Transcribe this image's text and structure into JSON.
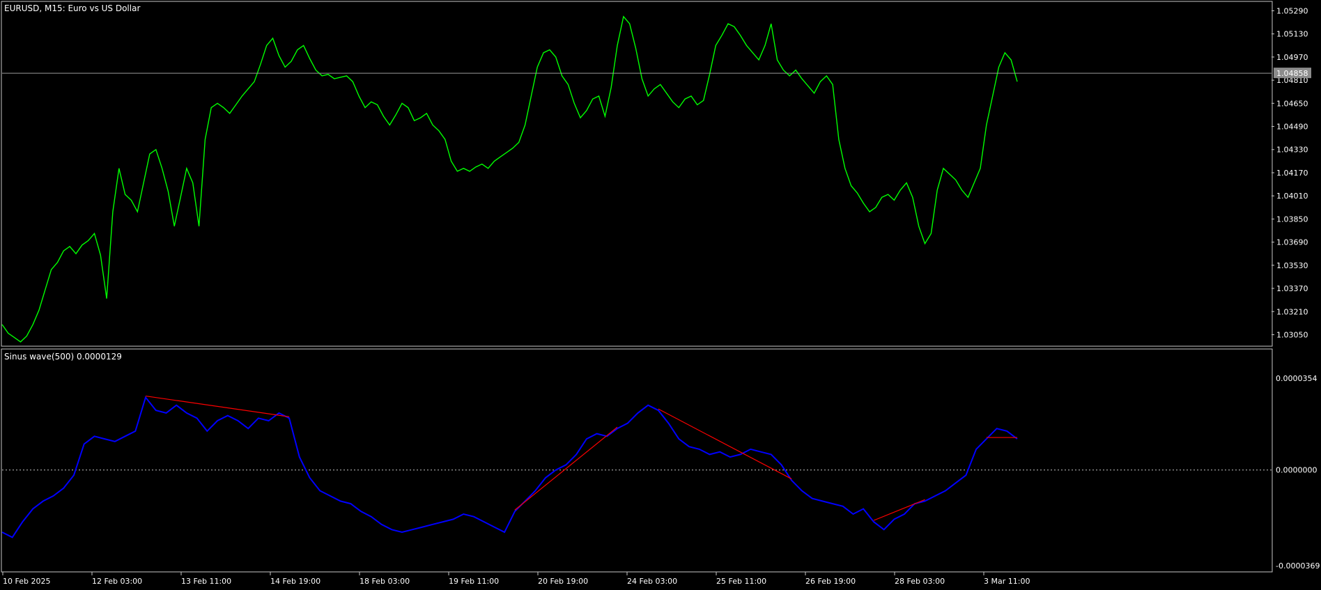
{
  "header": {
    "main_title": "EURUSD, M15:  Euro vs US Dollar",
    "indicator_title": "Sinus wave(500) 0.0000129"
  },
  "colors": {
    "background": "#000000",
    "price_line": "#00ff00",
    "indicator_line": "#0000ff",
    "divergence_line": "#ff0000",
    "frame": "#c8c8c8",
    "grid_zero": "#c8c8c8"
  },
  "price_axis": {
    "ticks": [
      "1.05290",
      "1.05130",
      "1.04970",
      "1.04810",
      "1.04650",
      "1.04490",
      "1.04330",
      "1.04170",
      "1.04010",
      "1.03850",
      "1.03690",
      "1.03530",
      "1.03370",
      "1.03210",
      "1.03050"
    ],
    "current_price": "1.04858"
  },
  "indicator_axis": {
    "ticks": [
      "0.0000354",
      "0.0000000",
      "-0.0000369"
    ]
  },
  "time_axis": {
    "labels": [
      "10 Feb 2025",
      "12 Feb 03:00",
      "13 Feb 11:00",
      "14 Feb 19:00",
      "18 Feb 03:00",
      "19 Feb 11:00",
      "20 Feb 19:00",
      "24 Feb 03:00",
      "25 Feb 11:00",
      "26 Feb 19:00",
      "28 Feb 03:00",
      "3 Mar 11:00"
    ]
  },
  "chart_data": [
    {
      "type": "line",
      "title": "EURUSD, M15:  Euro vs US Dollar",
      "ylim": [
        1.0298,
        1.0535
      ],
      "series": [
        {
          "name": "EURUSD",
          "x_labels_at_index": {
            "0": "10 Feb 2025",
            "20": "12 Feb 03:00",
            "40": "13 Feb 11:00",
            "60": "14 Feb 19:00",
            "80": "18 Feb 03:00",
            "100": "19 Feb 11:00",
            "120": "20 Feb 19:00",
            "140": "24 Feb 03:00",
            "160": "25 Feb 11:00",
            "180": "26 Feb 19:00",
            "200": "28 Feb 03:00",
            "220": "3 Mar 11:00"
          },
          "values": [
            1.0312,
            1.0306,
            1.0303,
            1.03,
            1.0304,
            1.0312,
            1.0322,
            1.0336,
            1.035,
            1.0355,
            1.0363,
            1.0366,
            1.0361,
            1.0367,
            1.037,
            1.0375,
            1.036,
            1.033,
            1.039,
            1.042,
            1.0402,
            1.0398,
            1.039,
            1.041,
            1.043,
            1.0433,
            1.042,
            1.0404,
            1.038,
            1.04,
            1.042,
            1.041,
            1.038,
            1.044,
            1.0462,
            1.0465,
            1.0462,
            1.0458,
            1.0464,
            1.047,
            1.0475,
            1.048,
            1.0492,
            1.0505,
            1.051,
            1.0498,
            1.049,
            1.0494,
            1.0502,
            1.0505,
            1.0496,
            1.0488,
            1.0484,
            1.0485,
            1.0482,
            1.0483,
            1.0484,
            1.048,
            1.047,
            1.0462,
            1.0466,
            1.0464,
            1.0456,
            1.045,
            1.0457,
            1.0465,
            1.0462,
            1.0453,
            1.0455,
            1.0458,
            1.045,
            1.0446,
            1.044,
            1.0425,
            1.0418,
            1.042,
            1.0418,
            1.0421,
            1.0423,
            1.042,
            1.0425,
            1.0428,
            1.0431,
            1.0434,
            1.0438,
            1.045,
            1.047,
            1.049,
            1.05,
            1.0502,
            1.0497,
            1.0484,
            1.0478,
            1.0465,
            1.0455,
            1.046,
            1.0468,
            1.047,
            1.0456,
            1.0476,
            1.0505,
            1.0525,
            1.052,
            1.0503,
            1.0482,
            1.047,
            1.0475,
            1.0478,
            1.0472,
            1.0466,
            1.0462,
            1.0468,
            1.047,
            1.0464,
            1.0467,
            1.0485,
            1.0505,
            1.0512,
            1.052,
            1.0518,
            1.0512,
            1.0505,
            1.05,
            1.0495,
            1.0505,
            1.052,
            1.0495,
            1.0488,
            1.0484,
            1.0488,
            1.0482,
            1.0477,
            1.0472,
            1.048,
            1.0484,
            1.0478,
            1.044,
            1.042,
            1.0408,
            1.0403,
            1.0396,
            1.039,
            1.0393,
            1.04,
            1.0402,
            1.0398,
            1.0405,
            1.041,
            1.04,
            1.038,
            1.0368,
            1.0375,
            1.0405,
            1.042,
            1.0416,
            1.0412,
            1.0405,
            1.04,
            1.041,
            1.042,
            1.045,
            1.047,
            1.049,
            1.05,
            1.0495,
            1.048
          ]
        }
      ]
    },
    {
      "type": "line",
      "title": "Sinus wave(500) 0.0000129",
      "ylim": [
        -3.69e-05,
        3.54e-05
      ],
      "series": [
        {
          "name": "Sinus wave(500)",
          "values": [
            -2.4e-05,
            -2.6e-05,
            -2e-05,
            -1.5e-05,
            -1.2e-05,
            -1e-05,
            -7e-06,
            -2e-06,
            1e-05,
            1.3e-05,
            1.2e-05,
            1.1e-05,
            1.3e-05,
            1.5e-05,
            2.8e-05,
            2.3e-05,
            2.2e-05,
            2.5e-05,
            2.2e-05,
            2e-05,
            1.5e-05,
            1.9e-05,
            2.1e-05,
            1.9e-05,
            1.6e-05,
            2e-05,
            1.9e-05,
            2.2e-05,
            2e-05,
            5e-06,
            -3e-06,
            -8e-06,
            -1e-05,
            -1.2e-05,
            -1.3e-05,
            -1.6e-05,
            -1.8e-05,
            -2.1e-05,
            -2.3e-05,
            -2.4e-05,
            -2.3e-05,
            -2.2e-05,
            -2.1e-05,
            -2e-05,
            -1.9e-05,
            -1.7e-05,
            -1.8e-05,
            -2e-05,
            -2.2e-05,
            -2.4e-05,
            -1.6e-05,
            -1.2e-05,
            -8e-06,
            -3e-06,
            0.0,
            2e-06,
            6e-06,
            1.2e-05,
            1.4e-05,
            1.3e-05,
            1.6e-05,
            1.8e-05,
            2.2e-05,
            2.5e-05,
            2.3e-05,
            1.8e-05,
            1.2e-05,
            9e-06,
            8e-06,
            6e-06,
            7e-06,
            5e-06,
            6e-06,
            8e-06,
            7e-06,
            6e-06,
            2e-06,
            -4e-06,
            -8e-06,
            -1.1e-05,
            -1.2e-05,
            -1.3e-05,
            -1.4e-05,
            -1.7e-05,
            -1.5e-05,
            -2e-05,
            -2.3e-05,
            -1.9e-05,
            -1.7e-05,
            -1.3e-05,
            -1.2e-05,
            -1e-05,
            -8e-06,
            -5e-06,
            -2e-06,
            8e-06,
            1.2e-05,
            1.6e-05,
            1.5e-05,
            1.2e-05
          ]
        }
      ]
    }
  ]
}
